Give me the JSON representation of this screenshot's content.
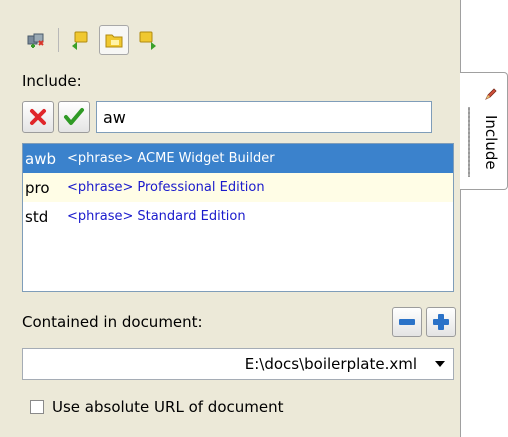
{
  "toolbar": {
    "buttons": [
      {
        "icon": "insert-remove-icon"
      },
      {
        "icon": "show-back-icon"
      },
      {
        "icon": "folder-pressed-icon",
        "pressed": true
      },
      {
        "icon": "forward-icon"
      }
    ]
  },
  "include_label": "Include:",
  "search": {
    "value": "aw",
    "placeholder": ""
  },
  "list": {
    "items": [
      {
        "key": "awb",
        "tag": "<phrase>",
        "desc": "ACME Widget Builder",
        "state": "selected"
      },
      {
        "key": "pro",
        "tag": "<phrase>",
        "desc": "Professional Edition",
        "state": "hover"
      },
      {
        "key": "std",
        "tag": "<phrase>",
        "desc": "Standard Edition",
        "state": "normal"
      }
    ]
  },
  "contained_label": "Contained in document:",
  "document_combo": {
    "value": "E:\\docs\\boilerplate.xml"
  },
  "absolute_url": {
    "label": "Use absolute URL of document",
    "checked": false
  },
  "side_tab": {
    "label": "Include"
  },
  "colors": {
    "selection": "#3b82cc",
    "panel": "#ece9d8",
    "link_text": "#1a1acc"
  }
}
